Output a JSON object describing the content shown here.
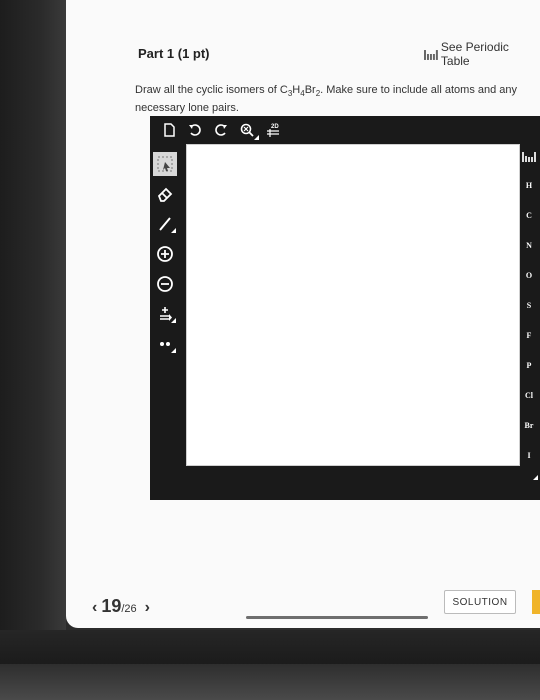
{
  "header": {
    "part_title": "Part 1 (1 pt)",
    "periodic_link": "See Periodic Table"
  },
  "question": {
    "prefix": "Draw all the cyclic isomers of C",
    "sub1": "3",
    "h": "H",
    "sub2": "4",
    "br": "Br",
    "sub3": "2",
    "suffix": ". Make sure to include all atoms and any necessary lone pairs."
  },
  "editor": {
    "top_toolbar": [
      "new-document-icon",
      "undo-icon",
      "redo-icon",
      "zoom-icon",
      "template-2d-icon"
    ],
    "template_label": "2D",
    "left_toolbar": [
      "select-icon",
      "eraser-icon",
      "single-bond-icon",
      "add-charge-icon",
      "remove-charge-icon",
      "charge-bond-icon",
      "lone-pair-icon"
    ],
    "elements": [
      "H",
      "C",
      "N",
      "O",
      "S",
      "F",
      "P",
      "Cl",
      "Br",
      "I"
    ]
  },
  "footer": {
    "prev": "‹",
    "current": "19",
    "total": "/26",
    "next": "›",
    "solution": "SOLUTION"
  },
  "colors": {
    "editor_bg": "#1a1a1a",
    "accent_next": "#f0b429"
  }
}
